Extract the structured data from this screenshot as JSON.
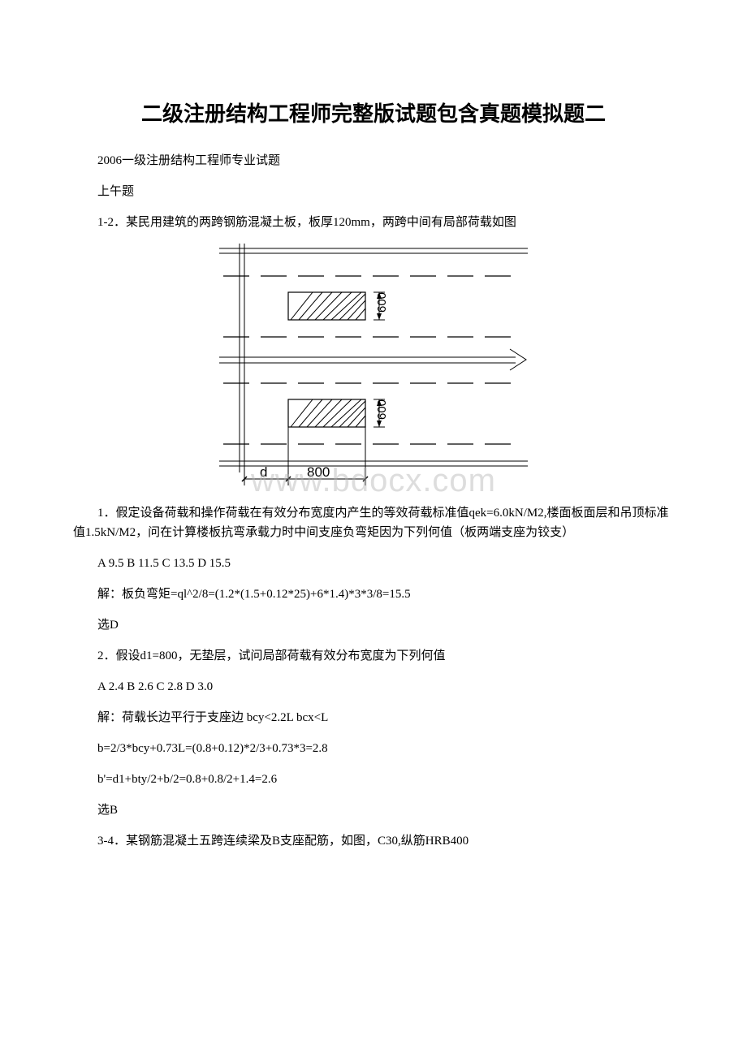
{
  "title": "二级注册结构工程师完整版试题包含真题模拟题二",
  "intro1": "2006一级注册结构工程师专业试题",
  "intro2": "上午题",
  "q1_stem": "1-2．某民用建筑的两跨钢筋混凝土板，板厚120mm，两跨中间有局部荷载如图",
  "diagram": {
    "dim_600_top": "600",
    "dim_600_bot": "600",
    "dim_d": "d",
    "dim_800": "800"
  },
  "q1_text": "1．假定设备荷载和操作荷载在有效分布宽度内产生的等效荷载标准值qek=6.0kN/M2,楼面板面层和吊顶标准值1.5kN/M2，问在计算楼板抗弯承载力时中间支座负弯矩因为下列何值（板两端支座为铰支）",
  "q1_opts": "A 9.5 B 11.5 C 13.5 D 15.5",
  "q1_sol": "解：板负弯矩=ql^2/8=(1.2*(1.5+0.12*25)+6*1.4)*3*3/8=15.5",
  "q1_ans": "选D",
  "q2_text": "2．假设d1=800，无垫层，试问局部荷载有效分布宽度为下列何值",
  "q2_opts": "A 2.4 B 2.6 C 2.8 D 3.0",
  "q2_sol1": "解：荷载长边平行于支座边 bcy<2.2L bcx<L",
  "q2_sol2": "b=2/3*bcy+0.73L=(0.8+0.12)*2/3+0.73*3=2.8",
  "q2_sol3": "b'=d1+bty/2+b/2=0.8+0.8/2+1.4=2.6",
  "q2_ans": "选B",
  "q3_text": "3-4．某钢筋混凝土五跨连续梁及B支座配筋，如图，C30,纵筋HRB400",
  "watermark": "www.bdocx.com"
}
